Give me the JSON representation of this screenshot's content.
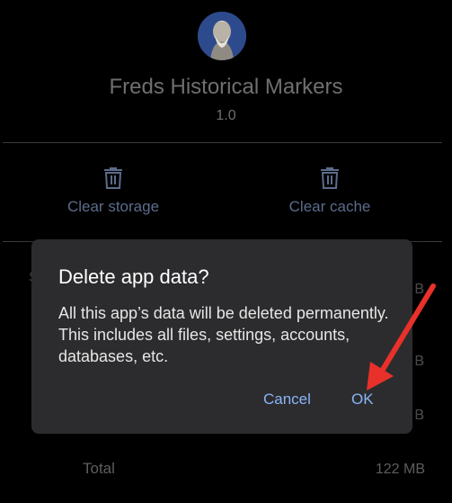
{
  "app": {
    "name": "Freds Historical Markers",
    "version": "1.0"
  },
  "actions": {
    "clear_storage": "Clear storage",
    "clear_cache": "Clear cache"
  },
  "rows": {
    "left_edge": "S",
    "b1": "B",
    "b2": "B",
    "b3": "B"
  },
  "total": {
    "label": "Total",
    "value": "122 MB"
  },
  "dialog": {
    "title": "Delete app data?",
    "message": "All this app’s data will be deleted permanently. This includes all files, settings, accounts, databases, etc.",
    "cancel": "Cancel",
    "ok": "OK"
  },
  "icons": {
    "avatar": "portrait-avatar",
    "trash": "trash-icon",
    "annotation": "red-arrow"
  },
  "colors": {
    "background": "#000000",
    "dialog": "#2c2c2e",
    "accent": "#8ab4f8",
    "arrow": "#e8312a"
  }
}
